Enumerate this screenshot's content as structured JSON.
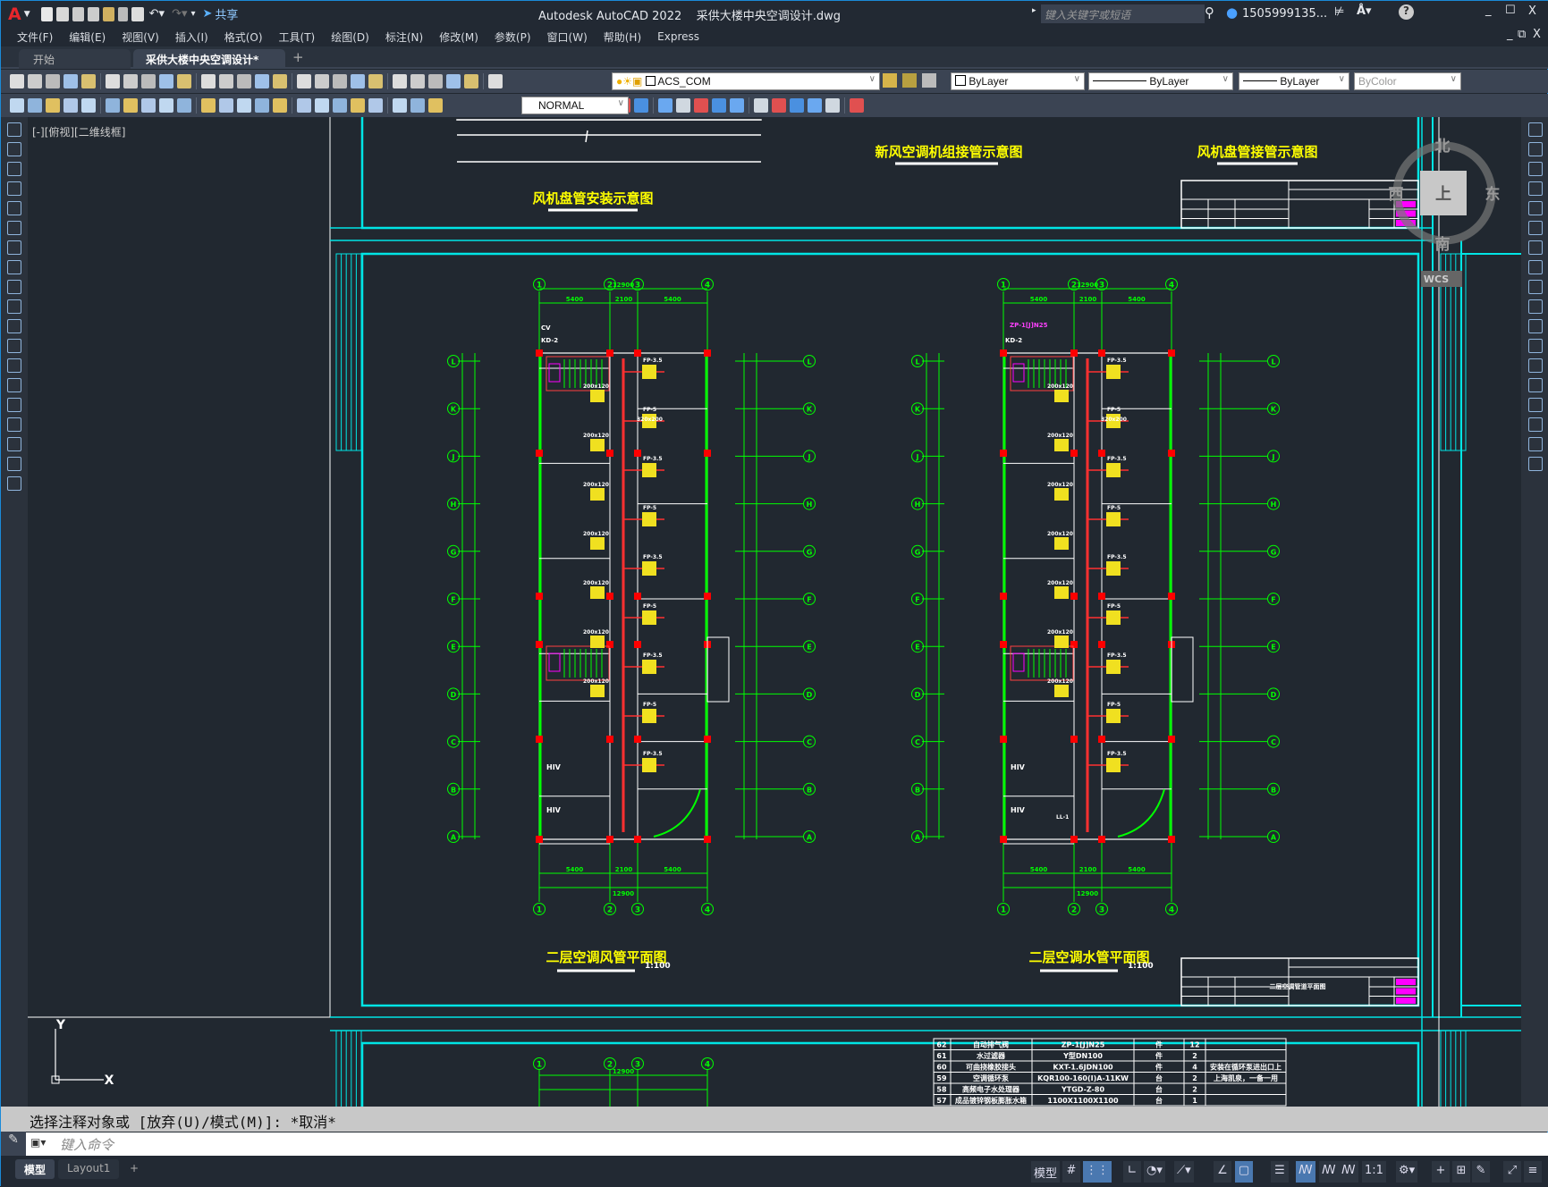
{
  "titlebar": {
    "app_logo": "A",
    "share": "共享",
    "title": "Autodesk AutoCAD 2022    采供大楼中央空调设计.dwg",
    "search_placeholder": "键入关键字或短语",
    "user": "1505999135...",
    "minimize": "_",
    "maximize": "☐",
    "close": "X"
  },
  "menu": [
    "文件(F)",
    "编辑(E)",
    "视图(V)",
    "插入(I)",
    "格式(O)",
    "工具(T)",
    "绘图(D)",
    "标注(N)",
    "修改(M)",
    "参数(P)",
    "窗口(W)",
    "帮助(H)",
    "Express"
  ],
  "tabs": {
    "start": "开始",
    "active": "采供大楼中央空调设计*",
    "close": "×",
    "add": "+"
  },
  "toolbar": {
    "layer": "ACS_COM",
    "color": "ByLayer",
    "linetype": "ByLayer",
    "lineweight": "ByLayer",
    "plotstyle": "ByColor",
    "dimstyle": "NORMAL",
    "row1_icons": [
      "new-icon",
      "open-icon",
      "save-icon",
      "plot-icon",
      "plot-preview-icon",
      "publish-icon",
      "3d-print-icon",
      "cut-icon",
      "copy-icon",
      "paste-icon",
      "match-properties-icon",
      "block-editor-icon",
      "undo-icon",
      "redo-icon",
      "pan-icon",
      "zoom-realtime-icon",
      "zoom-window-icon",
      "zoom-previous-icon",
      "properties-icon",
      "design-center-icon",
      "tool-palettes-icon",
      "sheet-set-icon",
      "markup-icon",
      "calculator-icon",
      "help-icon",
      "layer-properties-icon"
    ],
    "row2_icons": [
      "dim-edit-icon",
      "dim-update-icon",
      "dim-override-icon",
      "linear-dim-icon",
      "aligned-dim-icon",
      "arc-length-icon",
      "ordinate-icon",
      "radius-icon",
      "jogged-icon",
      "diameter-icon",
      "angular-icon",
      "quick-dim-icon",
      "baseline-icon",
      "continue-icon",
      "dim-space-icon",
      "dim-break-icon",
      "tolerance-icon",
      "center-mark-icon",
      "inspection-icon",
      "jogged-linear-icon",
      "dim-text-edit-icon",
      "dim-text-angle-icon",
      "dim-update2-icon"
    ],
    "row2b_icons": [
      "union-icon",
      "subtract-icon",
      "intersect-icon",
      "extrude-faces-icon",
      "move-faces-icon",
      "offset-faces-icon",
      "delete-faces-icon",
      "rotate-faces-icon",
      "taper-faces-icon",
      "copy-faces-icon",
      "color-faces-icon",
      "imprint-icon",
      "clean-icon",
      "separate-icon",
      "shell-icon",
      "check-icon"
    ]
  },
  "viewport_label": "[-][俯视][二维线框]",
  "viewcube": {
    "north": "北",
    "south": "南",
    "east": "东",
    "west": "西",
    "top": "上",
    "wcs": "WCS"
  },
  "ucs": {
    "x": "X",
    "y": "Y"
  },
  "drawing": {
    "titles": {
      "fcu_install": "风机盘管安装示意图",
      "fresh_air": "新风空调机组接管示意图",
      "fcu_pipe": "风机盘管接管示意图",
      "duct_plan": "二层空调风管平面图",
      "water_plan": "二层空调水管平面图",
      "scale": "1:100"
    },
    "axis_cols": [
      "1",
      "2",
      "3",
      "4"
    ],
    "axis_rows": [
      "A",
      "B",
      "C",
      "D",
      "E",
      "F",
      "G",
      "H",
      "J",
      "K",
      "L"
    ],
    "dims": {
      "total": "12900",
      "bay": "5400",
      "corridor": "2100"
    },
    "plan_labels": {
      "fcu": "FP-3.5",
      "fcu2": "FP-5",
      "hiv": "HIV",
      "kd": "KD-2",
      "cv": "CV",
      "duct1": "200x120",
      "duct2": "320x200",
      "ll": "LL-1",
      "zp": "ZP-1[J]N25"
    },
    "title_block_sheet": "二层空调管道平面图"
  },
  "equipment_table": {
    "rows": [
      [
        "62",
        "自动排气阀",
        "ZP-1[J]N25",
        "件",
        "12",
        ""
      ],
      [
        "61",
        "水过滤器",
        "Y型DN100",
        "件",
        "2",
        ""
      ],
      [
        "60",
        "可曲挠橡胶接头",
        "KXT-1.6JDN100",
        "件",
        "4",
        "安装在循环泵进出口上"
      ],
      [
        "59",
        "空调循环泵",
        "KQR100-160(I)A-11KW",
        "台",
        "2",
        "上海凯泉，一备一用"
      ],
      [
        "58",
        "高频电子水处理器",
        "YTGD-Z-80",
        "台",
        "2",
        ""
      ],
      [
        "57",
        "成品镀锌钢板膨胀水箱",
        "1100X1100X1100",
        "台",
        "1",
        ""
      ]
    ]
  },
  "command": {
    "history": "选择注释对象或 [放弃(U)/模式(M)]: *取消*",
    "placeholder": "键入命令"
  },
  "layout_tabs": [
    "模型",
    "Layout1",
    "+"
  ],
  "status": {
    "model": "模型",
    "scale": "1:1"
  },
  "colors": {
    "canvas": "#212830",
    "frame": "#00e5e5",
    "title_text": "#ffff00",
    "axis": "#00ff00",
    "wall": "#ffffff",
    "column": "#ff0000",
    "magenta": "#ff00ff"
  }
}
